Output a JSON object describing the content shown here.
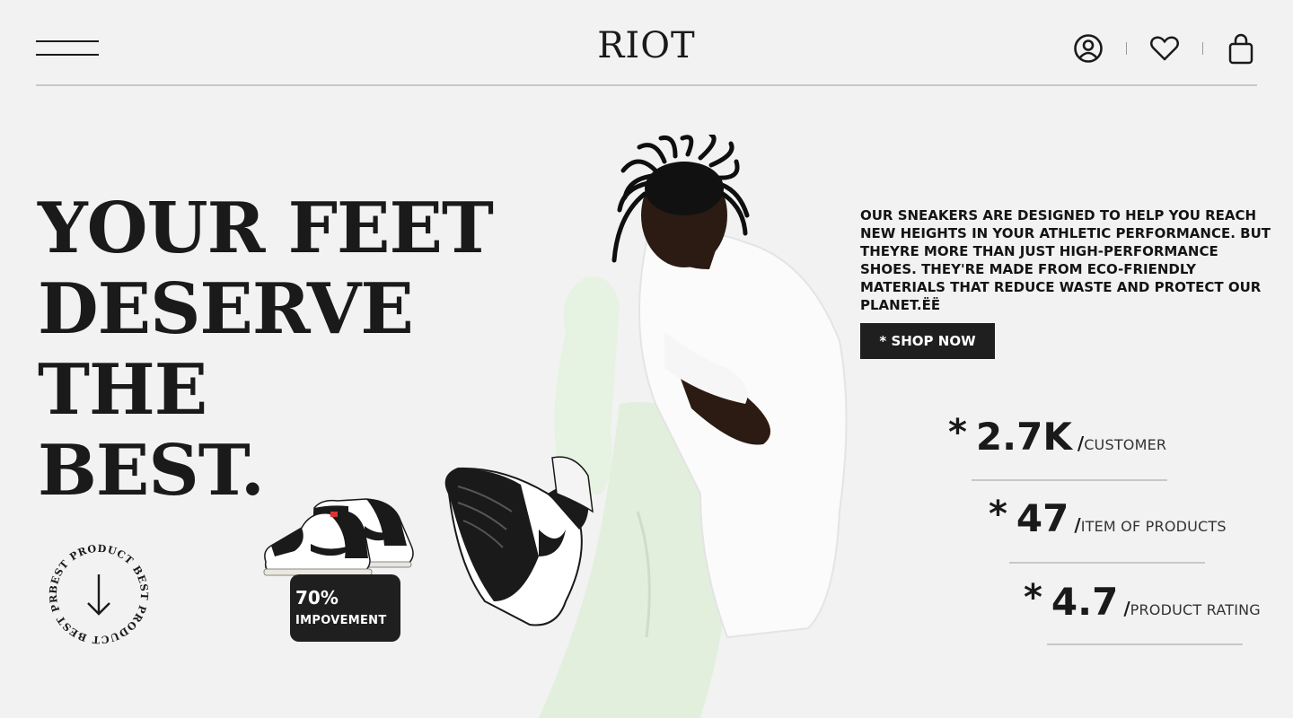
{
  "header": {
    "logo": "RIOT",
    "icons": [
      "menu-icon",
      "user-icon",
      "heart-icon",
      "bag-icon"
    ]
  },
  "hero": {
    "headline_lines": [
      "YOUR FEET",
      "DESERVE THE",
      "BEST."
    ],
    "description": "OUR SNEAKERS ARE DESIGNED TO HELP YOU REACH NEW HEIGHTS IN YOUR ATHLETIC PERFORMANCE. BUT THEYRE MORE THAN JUST HIGH-PERFORMANCE SHOES. THEY'RE MADE FROM ECO-FRIENDLY MATERIALS THAT REDUCE WASTE AND PROTECT OUR PLANET.ËË",
    "shop_button": "* SHOP NOW"
  },
  "badge": {
    "text": "BEST PRODUCT BEST PRODUCT BEST PRODUCT"
  },
  "product_card": {
    "value": "70%",
    "label": "IMPOVEMENT"
  },
  "stats": [
    {
      "star": "*",
      "value": "2.7K",
      "slash": "/",
      "label": "CUSTOMER"
    },
    {
      "star": "*",
      "value": "47",
      "slash": "/",
      "label": "ITEM OF PRODUCTS"
    },
    {
      "star": "*",
      "value": "4.7",
      "slash": "/",
      "label": "PRODUCT RATING"
    }
  ],
  "colors": {
    "background": "#f2f2f2",
    "text": "#1a1a1a",
    "button": "#1f1f1f",
    "pants": "#e6f2e2"
  }
}
